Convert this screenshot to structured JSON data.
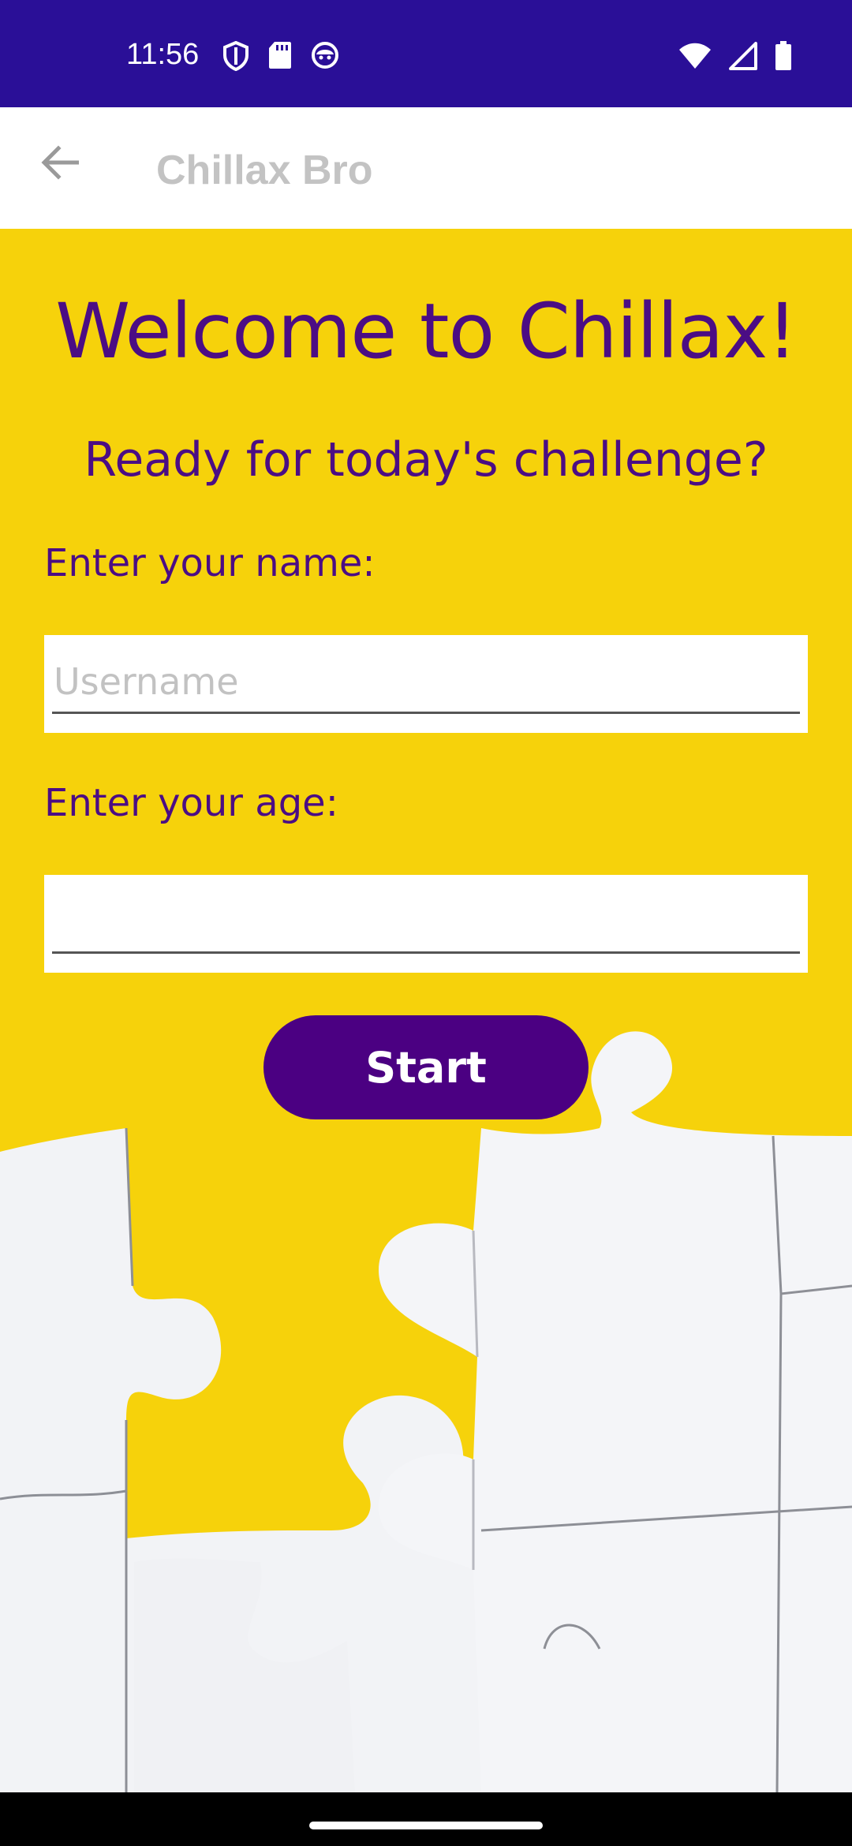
{
  "status_bar": {
    "time": "11:56",
    "background_color": "#2a0f97",
    "icons": [
      "shield-icon",
      "sd-card-icon",
      "notification-face-icon",
      "wifi-icon",
      "cellular-signal-icon",
      "battery-icon"
    ]
  },
  "app_bar": {
    "title": "Chillax Bro",
    "back_icon": "arrow-left-icon"
  },
  "main": {
    "welcome": "Welcome to Chillax!",
    "subtitle": "Ready for today's challenge?",
    "name_label": "Enter your name:",
    "name_placeholder": "Username",
    "name_value": "",
    "age_label": "Enter your age:",
    "age_placeholder": "",
    "age_value": "",
    "start_label": "Start",
    "accent_color": "#4b0082",
    "background_color": "#f6d20b"
  }
}
